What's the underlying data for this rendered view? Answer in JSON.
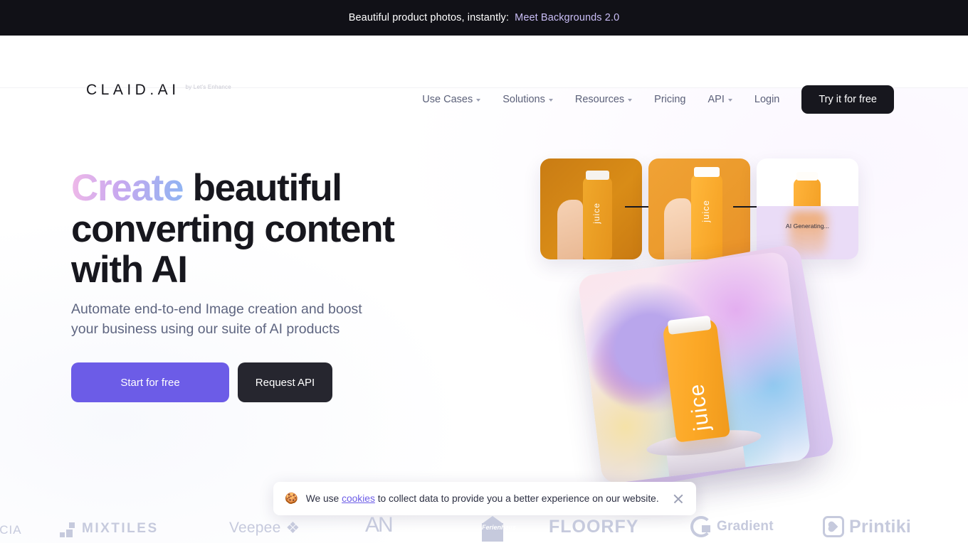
{
  "announcement": {
    "text": "Beautiful product photos, instantly:",
    "link_label": "Meet Backgrounds 2.0",
    "background_color": "#111117",
    "link_color": "#c9bdf5"
  },
  "header": {
    "logo": {
      "name": "CLAID.AI",
      "tagline": "by Let's Enhance"
    },
    "nav": [
      {
        "label": "Use Cases",
        "has_dropdown": true
      },
      {
        "label": "Solutions",
        "has_dropdown": true
      },
      {
        "label": "Resources",
        "has_dropdown": true
      },
      {
        "label": "Pricing",
        "has_dropdown": false
      },
      {
        "label": "API",
        "has_dropdown": true
      },
      {
        "label": "Login",
        "has_dropdown": false
      }
    ],
    "cta_label": "Try it for free",
    "cta_background": "#17171e"
  },
  "hero": {
    "title_gradient_word": "Create",
    "title_rest": " beautiful converting content with AI",
    "subtitle": "Automate end-to-end Image creation and boost your business using our suite of AI products",
    "primary_button": "Start for free",
    "secondary_button": "Request API",
    "primary_color": "#6c5ce7",
    "secondary_color": "#26262f",
    "gradient_colors": [
      "#f0b9e8",
      "#c9a8ef",
      "#8fb4f2"
    ]
  },
  "hero_art": {
    "product_label": "juice",
    "generating_label": "AI Generating...",
    "steps": 3
  },
  "cookie_banner": {
    "icon": "cookie-icon",
    "emoji": "🍪",
    "text_before": "We use",
    "link_label": "cookies",
    "text_after": "to collect data to provide you a better experience on our website.",
    "close_label": "close"
  },
  "client_logos": [
    {
      "name": "NCIA"
    },
    {
      "name": "MIXTILES"
    },
    {
      "name": "Veepee"
    },
    {
      "name": "AN"
    },
    {
      "name": "Ferienhaus"
    },
    {
      "name": "FLOORFY"
    },
    {
      "name": "Gradient"
    },
    {
      "name": "Printiki"
    }
  ]
}
